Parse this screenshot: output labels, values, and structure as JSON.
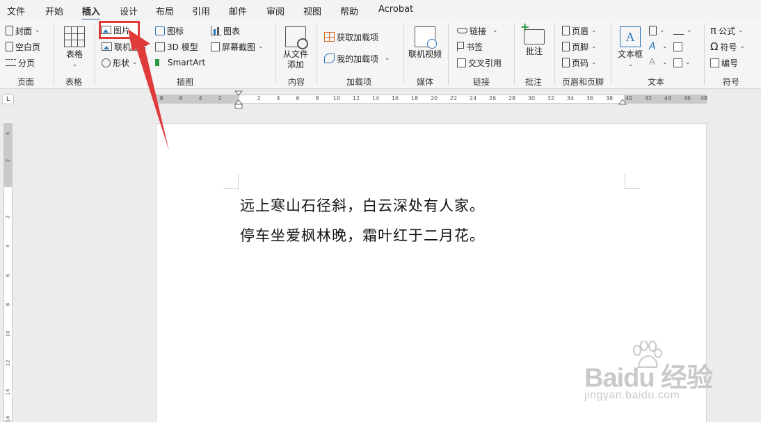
{
  "tabs": [
    "文件",
    "开始",
    "插入",
    "设计",
    "布局",
    "引用",
    "邮件",
    "审阅",
    "视图",
    "帮助",
    "Acrobat"
  ],
  "active_tab": "插入",
  "groups": [
    "页面",
    "表格",
    "插图",
    "内容",
    "加载项",
    "媒体",
    "链接",
    "批注",
    "页眉和页脚",
    "文本",
    "符号"
  ],
  "ribbon": {
    "pages": {
      "cover": "封面",
      "blank": "空白页",
      "break": "分页"
    },
    "table": {
      "label": "表格"
    },
    "illustrations": {
      "picture": "图片",
      "online_picture": "联机图片",
      "shapes": "形状",
      "icons": "图标",
      "model3d": "3D 模型",
      "smartart": "SmartArt",
      "chart": "图表",
      "screenshot": "屏幕截图"
    },
    "content": {
      "from_file_1": "从文件",
      "from_file_2": "添加"
    },
    "addins": {
      "get": "获取加载项",
      "mine": "我的加载项"
    },
    "media": {
      "online_video": "联机视频"
    },
    "links": {
      "link": "链接",
      "bookmark": "书签",
      "crossref": "交叉引用"
    },
    "comments": {
      "comment": "批注"
    },
    "header_footer": {
      "header": "页眉",
      "footer": "页脚",
      "page_number": "页码"
    },
    "text": {
      "textbox": "文本框"
    },
    "symbols": {
      "equation": "公式",
      "symbol": "符号",
      "number": "编号"
    }
  },
  "ruler": {
    "h_left": [
      "8",
      "6",
      "4",
      "2"
    ],
    "h_right": [
      "2",
      "4",
      "6",
      "8",
      "10",
      "12",
      "14",
      "16",
      "18",
      "20",
      "22",
      "24",
      "26",
      "28",
      "30",
      "32",
      "34",
      "36",
      "38",
      "40",
      "42",
      "44",
      "46",
      "48"
    ],
    "v_top": [
      "4",
      "2"
    ],
    "v_bottom": [
      "2",
      "4",
      "6",
      "8",
      "10",
      "12",
      "14",
      "16"
    ],
    "corner": "L"
  },
  "document": {
    "lines": [
      "远上寒山石径斜，白云深处有人家。",
      "停车坐爱枫林晚，霜叶红于二月花。"
    ]
  },
  "watermark": {
    "brand": "Baidu",
    "cn": "经验",
    "url": "jingyan.baidu.com"
  },
  "colors": {
    "accent": "#2b579a",
    "highlight": "#e03b3b"
  }
}
